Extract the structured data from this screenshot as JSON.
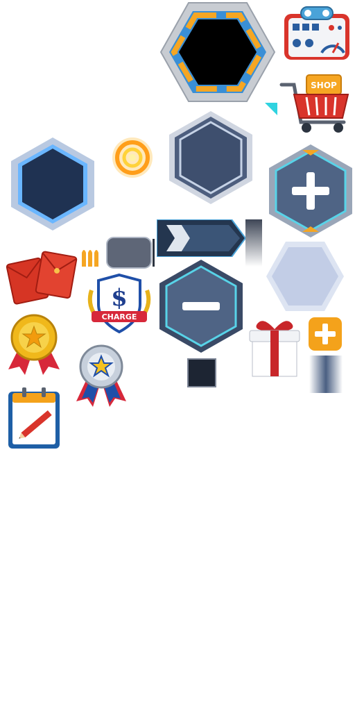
{
  "sprite_sheet": {
    "shop_label": "SHOP",
    "charge_label": "CHARGE",
    "dollar_sign": "$",
    "colors": {
      "frame_orange": "#f5a623",
      "frame_blue": "#3a8fd6",
      "hex_dark": "#1f3252",
      "hex_slate": "#3e4f6e",
      "hex_glow": "#6ab6ff",
      "cyan_border": "#58d3e8",
      "button_orange": "#f4a21b",
      "gift_red": "#c8262a",
      "envelope_red": "#d63524",
      "medal_gold": "#f0b81b",
      "medal_silver": "#c7d0dc",
      "ribbon_red": "#d7283a",
      "ribbon_blue": "#1f4fa8",
      "cart_red": "#d9342b"
    }
  }
}
